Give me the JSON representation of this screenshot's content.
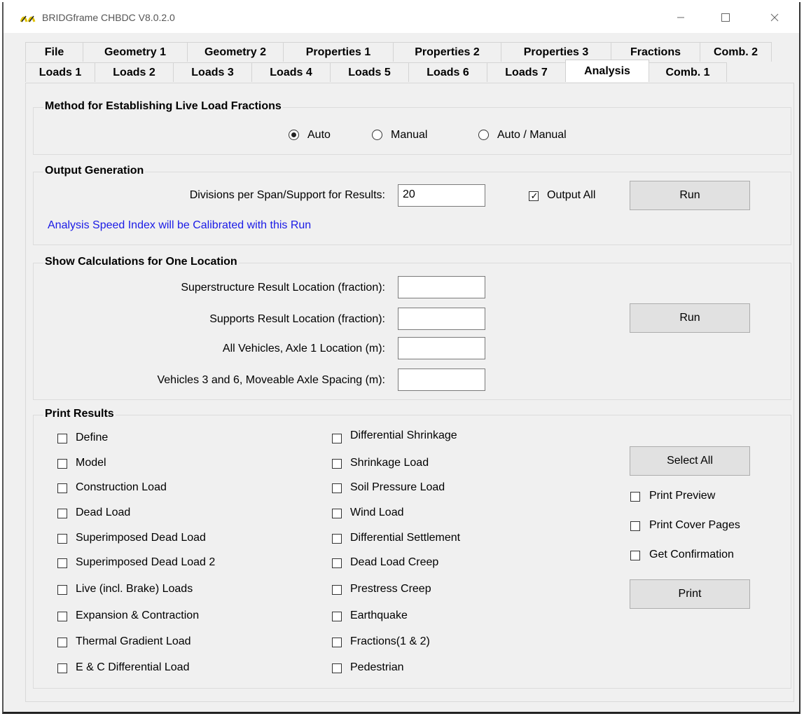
{
  "window": {
    "title": "BRIDGframe CHBDC  V8.0.2.0"
  },
  "tabs_row1": [
    "File",
    "Geometry 1",
    "Geometry 2",
    "Properties 1",
    "Properties 2",
    "Properties 3",
    "Fractions",
    "Comb. 2"
  ],
  "tabs_row2": [
    "Loads 1",
    "Loads 2",
    "Loads 3",
    "Loads 4",
    "Loads 5",
    "Loads 6",
    "Loads 7",
    "Analysis",
    "Comb. 1"
  ],
  "active_tab": "Analysis",
  "method": {
    "title": "Method for Establishing Live Load Fractions",
    "options": [
      "Auto",
      "Manual",
      "Auto / Manual"
    ],
    "selected": "Auto"
  },
  "output": {
    "title": "Output Generation",
    "divisions_label": "Divisions per Span/Support for Results:",
    "divisions_value": "20",
    "output_all_label": "Output All",
    "output_all_checked": true,
    "run_label": "Run",
    "note": "Analysis Speed Index will be Calibrated with this Run"
  },
  "location": {
    "title": "Show Calculations for One Location",
    "fields": [
      {
        "label": "Superstructure Result Location (fraction):",
        "value": ""
      },
      {
        "label": "Supports Result Location (fraction):",
        "value": ""
      },
      {
        "label": "All Vehicles, Axle 1 Location (m):",
        "value": ""
      },
      {
        "label": "Vehicles 3 and 6,  Moveable Axle Spacing (m):",
        "value": ""
      }
    ],
    "run_label": "Run"
  },
  "print": {
    "title": "Print Results",
    "col1": [
      "Define",
      "Model",
      "Construction Load",
      "Dead Load",
      "Superimposed Dead Load",
      "Superimposed Dead Load 2",
      "Live (incl. Brake) Loads",
      "Expansion & Contraction",
      "Thermal Gradient Load",
      "E & C Differential Load"
    ],
    "col2": [
      "Differential Shrinkage",
      "Shrinkage Load",
      "Soil Pressure Load",
      "Wind Load",
      "Differential Settlement",
      "Dead Load Creep",
      "Prestress Creep",
      "Earthquake",
      "Fractions(1 & 2)",
      "Pedestrian"
    ],
    "select_all_label": "Select All",
    "options": [
      "Print Preview",
      "Print Cover Pages",
      "Get Confirmation"
    ],
    "print_label": "Print"
  }
}
